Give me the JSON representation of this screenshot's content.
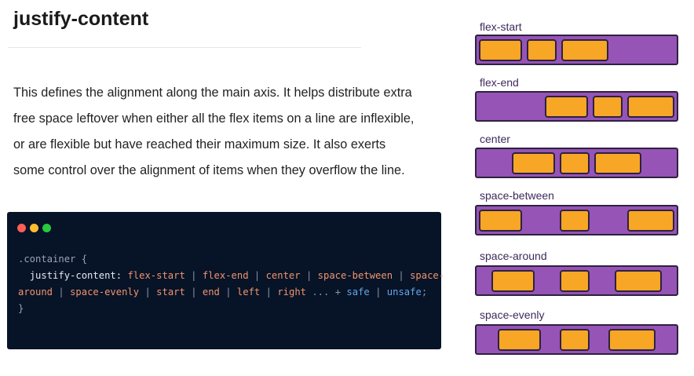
{
  "page": {
    "title": "justify-content",
    "description_lines": [
      "This defines the alignment along the main axis. It helps distribute extra",
      "free space leftover when either all the flex items on a line are inflexible,",
      "or are flexible but have reached their maximum size. It also exerts",
      "some control over the alignment of items when they overflow the line."
    ]
  },
  "code": {
    "window_dots": [
      "#ff5f56",
      "#ffbd2e",
      "#27c93f"
    ],
    "selector": ".container {",
    "property": "justify-content:",
    "values_line1": [
      "flex-start",
      "flex-end",
      "center",
      "space-between",
      "space-"
    ],
    "values_line2": [
      "around",
      "space-evenly",
      "start",
      "end",
      "left",
      "right"
    ],
    "ellipsis": "...",
    "plus": "+",
    "kw_safe": "safe",
    "kw_unsafe": "unsafe",
    "separator": "|",
    "semicolon": ";",
    "close_brace": "}"
  },
  "diagrams": [
    {
      "label": "flex-start"
    },
    {
      "label": "flex-end"
    },
    {
      "label": "center"
    },
    {
      "label": "space-between"
    },
    {
      "label": "space-around"
    },
    {
      "label": "space-evenly"
    }
  ],
  "colors": {
    "container_purple": "#9654b6",
    "item_orange": "#f7a625",
    "outline": "#2e2140",
    "code_background": "#071327",
    "code_value": "#f0956e",
    "code_keyword": "#62a8ee"
  }
}
